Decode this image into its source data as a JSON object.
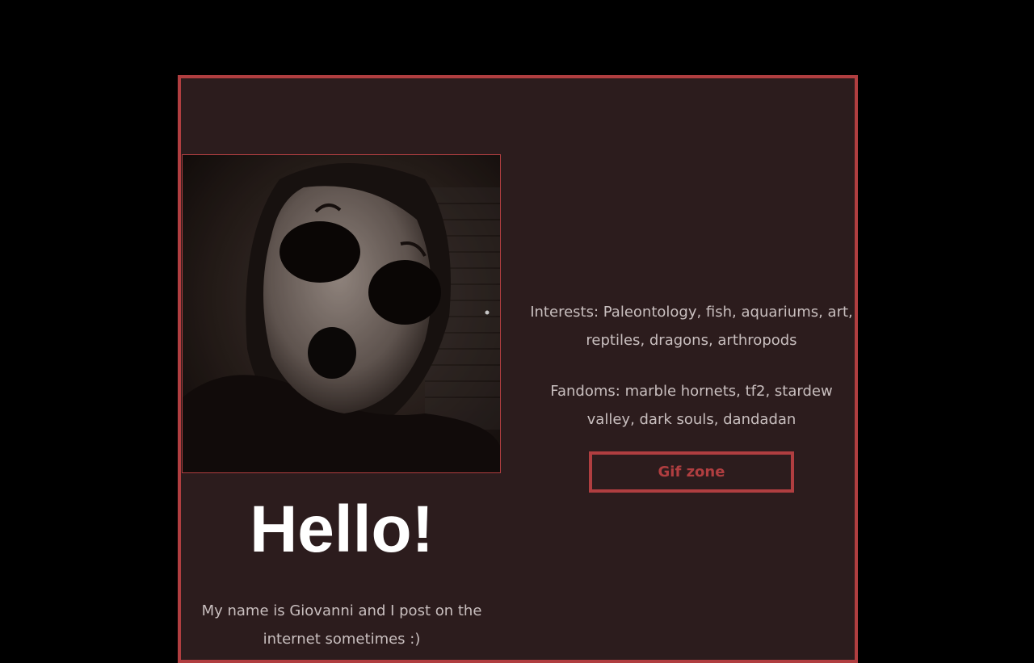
{
  "profile": {
    "photo": {
      "alt": "masked figure photo",
      "icon": "profile-photo"
    },
    "greeting": "Hello!",
    "intro": "My name is Giovanni and I post on the internet sometimes :)"
  },
  "about": {
    "interests": "Interests: Paleontology, fish, aquariums, art, reptiles, dragons, arthropods",
    "fandoms": "Fandoms: marble hornets, tf2, stardew valley, dark souls, dandadan"
  },
  "links": {
    "gif_zone_label": "Gif zone"
  },
  "colors": {
    "page_background": "#000000",
    "card_background": "#2c1c1d",
    "accent": "#b03e40",
    "body_text": "#c9bfbf",
    "heading_text": "#ffffff"
  }
}
